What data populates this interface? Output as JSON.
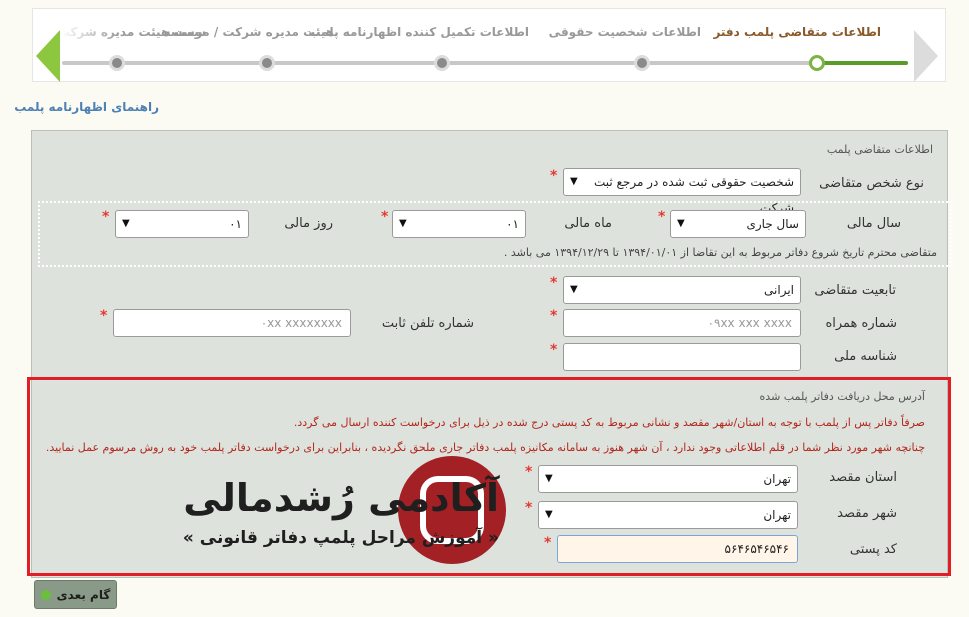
{
  "wizard": {
    "steps": [
      {
        "label": "اطلاعات متقاضی پلمب دفتر",
        "active": true
      },
      {
        "label": "اطلاعات شخصیت حقوقی",
        "active": false
      },
      {
        "label": "اطلاعات تکمیل کننده اظهارنامه پلمب",
        "active": false
      },
      {
        "label": "هیئت مدیره شرکت / موسسه",
        "active": false
      },
      {
        "label": "سمت هیئت مدیره شرکت / م",
        "active": false
      }
    ]
  },
  "guide_link": "راهنمای اظهارنامه پلمب",
  "form": {
    "section_title": "اطلاعات متقاضی پلمب",
    "person_type": {
      "label": "نوع شخص متقاضی",
      "value": "شخصیت حقوقی ثبت شده در مرجع ثبت شرکت"
    },
    "fiscal_year": {
      "label": "سال مالی",
      "value": "سال جاری"
    },
    "fiscal_month": {
      "label": "ماه مالی",
      "value": "۰۱"
    },
    "fiscal_day": {
      "label": "روز مالی",
      "value": "۰۱"
    },
    "fiscal_note": "متقاضی محترم تاریخ شروع دفاتر مربوط به این تقاضا از ۱۳۹۴/۰۱/۰۱ تا ۱۳۹۴/۱۲/۲۹ می باشد .",
    "nationality": {
      "label": "تابعیت متقاضی",
      "value": "ایرانی"
    },
    "mobile": {
      "label": "شماره همراه",
      "placeholder": "۰۹xx xxx xxxx"
    },
    "phone": {
      "label": "شماره تلفن ثابت",
      "placeholder": "۰xx xxxxxxxx"
    },
    "national_id": {
      "label": "شناسه ملی",
      "value": ""
    }
  },
  "address": {
    "title": "آدرس محل دریافت دفاتر پلمب شده",
    "note1": "صرفاً دفاتر پس از پلمب با توجه به استان/شهر مقصد و نشانی مربوط به کد پستی درج شده در ذیل برای درخواست کننده ارسال می گردد.",
    "note2": "چنانچه شهر مورد نظر شما در قلم اطلاعاتی وجود ندارد ، آن شهر هنوز به سامانه مکانیزه پلمب دفاتر جاری ملحق نگردیده ، بنابراین برای درخواست دفاتر پلمب خود به روش مرسوم عمل نمایید.",
    "province": {
      "label": "استان مقصد",
      "value": "تهران"
    },
    "city": {
      "label": "شهر مقصد",
      "value": "تهران"
    },
    "postal": {
      "label": "کد پستی",
      "value": "۵۶۴۶۵۴۶۵۴۶"
    }
  },
  "watermark": {
    "title": "آکادمی رُشدمالی",
    "subtitle": "« آموزش مراحل پلمپ دفاتر قانونی »"
  },
  "buttons": {
    "next": "گام بعدی"
  },
  "colors": {
    "accent": "#5a9b2c",
    "required": "#e53935",
    "highlight": "#e11d26",
    "brand": "#a32124"
  }
}
